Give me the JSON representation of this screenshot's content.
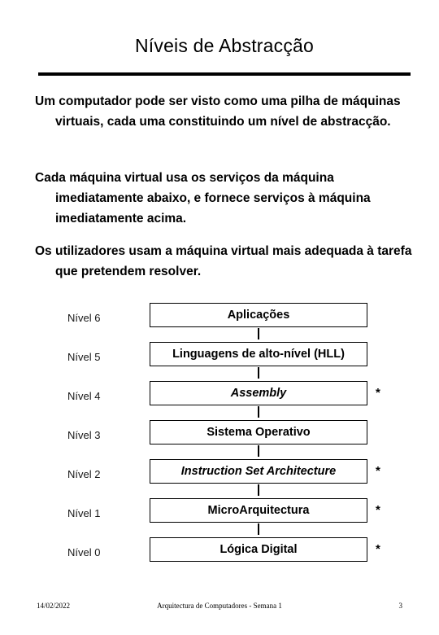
{
  "slide": {
    "title": "Níveis de Abstracção",
    "paragraphs": [
      "Um computador pode ser visto como uma pilha de máquinas virtuais, cada uma constituindo um nível de abstracção.",
      "Cada máquina virtual usa os serviços da máquina imediatamente abaixo, e fornece serviços à máquina imediatamente acima.",
      "Os utilizadores usam a máquina virtual mais adequada à tarefa que pretendem resolver."
    ],
    "levels": [
      {
        "label": "Nível 6",
        "name": "Aplicações",
        "italic": false,
        "star": ""
      },
      {
        "label": "Nível 5",
        "name": "Linguagens de alto-nível (HLL)",
        "italic": false,
        "star": ""
      },
      {
        "label": "Nível 4",
        "name": "Assembly",
        "italic": true,
        "star": "*"
      },
      {
        "label": "Nível 3",
        "name": "Sistema Operativo",
        "italic": false,
        "star": ""
      },
      {
        "label": "Nível 2",
        "name": "Instruction Set Architecture",
        "italic": true,
        "star": "*"
      },
      {
        "label": "Nível 1",
        "name": "MicroArquitectura",
        "italic": false,
        "star": "*"
      },
      {
        "label": "Nível 0",
        "name": "Lógica Digital",
        "italic": false,
        "star": "*"
      }
    ],
    "footer": {
      "date": "14/02/2022",
      "center": "Arquitectura de Computadores - Semana 1",
      "page": "3"
    },
    "colors": {
      "text": "#000000",
      "background": "#ffffff",
      "rule": "#000000",
      "box_border": "#000000"
    }
  }
}
